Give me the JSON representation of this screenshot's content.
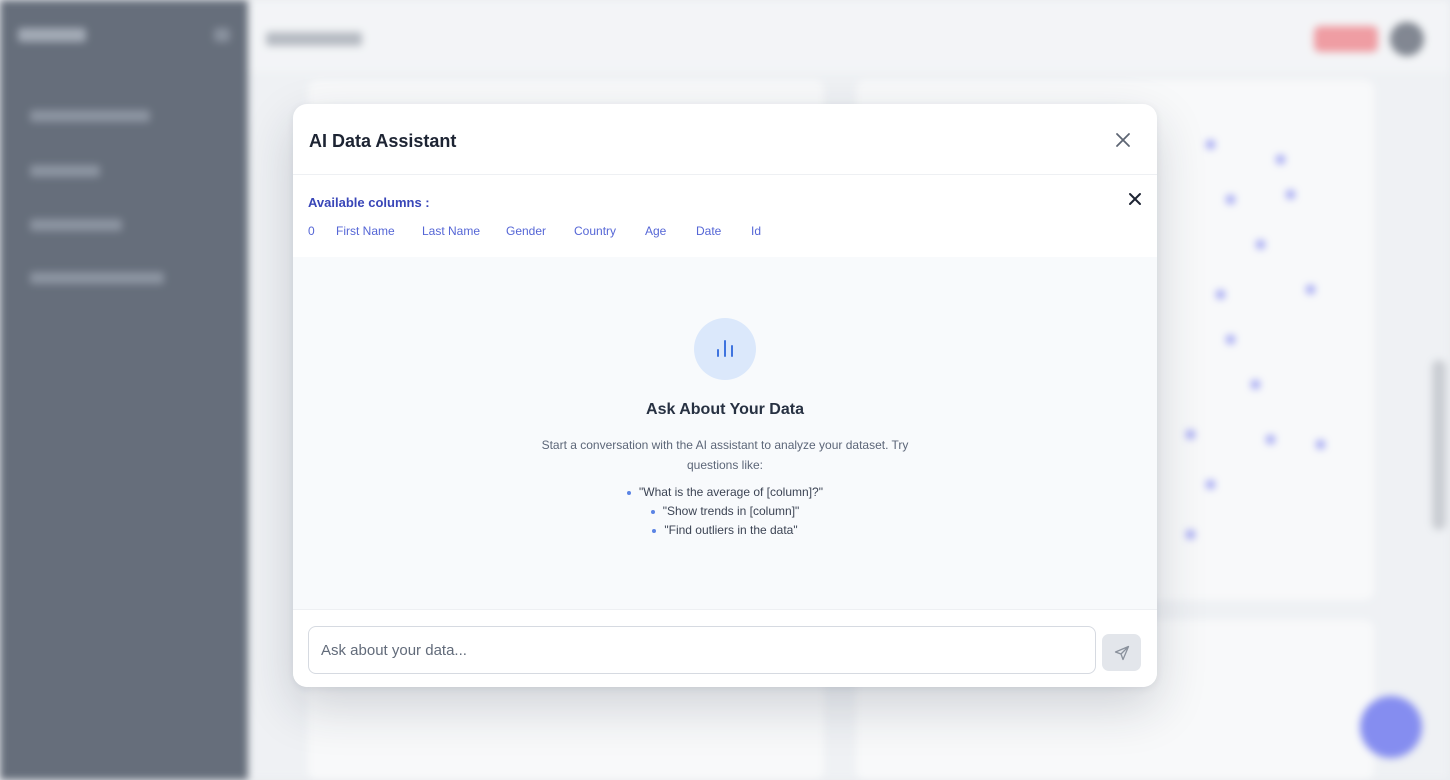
{
  "modal": {
    "title": "AI Data Assistant"
  },
  "columns": {
    "title": "Available columns :",
    "items": [
      "0",
      "First Name",
      "Last Name",
      "Gender",
      "Country",
      "Age",
      "Date",
      "Id"
    ]
  },
  "empty_state": {
    "icon": "bar-chart-icon",
    "title": "Ask About Your Data",
    "description": "Start a conversation with the AI assistant to analyze your dataset. Try questions like:",
    "suggestions": [
      "\"What is the average of [column]?\"",
      "\"Show trends in [column]\"",
      "\"Find outliers in the data\""
    ]
  },
  "composer": {
    "placeholder": "Ask about your data...",
    "value": ""
  },
  "colors": {
    "accent": "#5566d6",
    "fab": "#4f5af0",
    "sidebar": "#1f2a3c"
  }
}
